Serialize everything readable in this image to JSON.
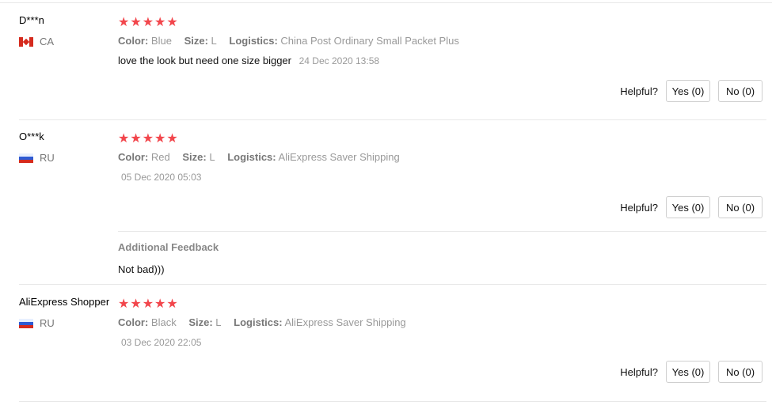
{
  "reviews": [
    {
      "user": "D***n",
      "country": "CA",
      "stars": "★★★★★",
      "attributes": {
        "color_label": "Color:",
        "color": "Blue",
        "size_label": "Size:",
        "size": "L",
        "logistics_label": "Logistics:",
        "logistics": "China Post Ordinary Small Packet Plus"
      },
      "text": "love the look but need one size bigger",
      "time": "24 Dec 2020 13:58",
      "helpful_label": "Helpful?",
      "yes_label": "Yes (0)",
      "no_label": "No (0)"
    },
    {
      "user": "O***k",
      "country": "RU",
      "stars": "★★★★★",
      "attributes": {
        "color_label": "Color:",
        "color": "Red",
        "size_label": "Size:",
        "size": "L",
        "logistics_label": "Logistics:",
        "logistics": "AliExpress Saver Shipping"
      },
      "text": "",
      "time": "05 Dec 2020 05:03",
      "helpful_label": "Helpful?",
      "yes_label": "Yes (0)",
      "no_label": "No (0)",
      "additional_title": "Additional Feedback",
      "additional_text": "Not bad)))"
    },
    {
      "user": "AliExpress Shopper",
      "country": "RU",
      "stars": "★★★★★",
      "attributes": {
        "color_label": "Color:",
        "color": "Black",
        "size_label": "Size:",
        "size": "L",
        "logistics_label": "Logistics:",
        "logistics": "AliExpress Saver Shipping"
      },
      "text": "",
      "time": "03 Dec 2020 22:05",
      "helpful_label": "Helpful?",
      "yes_label": "Yes (0)",
      "no_label": "No (0)"
    }
  ],
  "colors": {
    "star": "#f2464c",
    "divider": "#e8e8e8"
  },
  "icons": [
    "canada-flag-icon",
    "russia-flag-icon"
  ]
}
